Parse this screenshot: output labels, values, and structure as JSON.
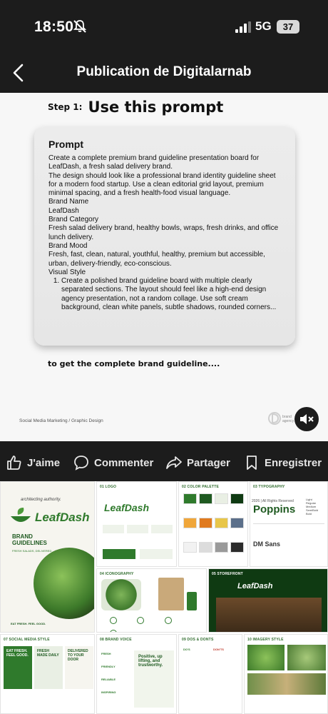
{
  "status": {
    "time": "18:50",
    "network": "5G",
    "battery": "37"
  },
  "nav": {
    "title": "Publication de Digitalarnab"
  },
  "post": {
    "step_label": "Step 1:",
    "step_title": "Use this prompt",
    "prompt_heading": "Prompt",
    "prompt_paragraphs": [
      "Create a complete premium brand guideline presentation board for LeafDash, a fresh salad delivery brand.",
      "The design should look like a professional brand identity guideline sheet for a modern food startup. Use a clean editorial grid layout, premium minimal spacing, and a fresh health-food visual language.",
      "Brand Name",
      "LeafDash",
      "Brand Category",
      "Fresh salad delivery brand, healthy bowls, wraps, fresh drinks, and office lunch delivery.",
      "Brand Mood",
      "Fresh, fast, clean, natural, youthful, healthy, premium but accessible, urban, delivery-friendly, eco-conscious.",
      "Visual Style"
    ],
    "prompt_list_item": "Create a polished brand guideline board with multiple clearly separated sections. The layout should feel like a high-end design agency presentation, not a random collage. Use soft cream background, clean white panels, subtle shadows, rounded corners...",
    "cta": "to get the complete brand guideline....",
    "footer": "Social Media Marketing / Graphic Design",
    "brand_mark": "brand agency"
  },
  "actions": {
    "like": "J'aime",
    "comment": "Commenter",
    "share": "Partager",
    "save": "Enregistrer"
  },
  "board": {
    "tagline": "architecting authority.",
    "brand": "LeafDash",
    "guidelines_title": "BRAND GUIDELINES",
    "guidelines_sub": "FRESH SALADS, DELIVERED",
    "eat_fresh": "EAT FRESH. FEEL GOOD.",
    "sections": {
      "logo": "01 LOGO",
      "palette": "02 COLOR PALETTE",
      "typography": "03 TYPOGRAPHY",
      "icons": "04 ICONOGRAPHY",
      "storefront": "05 STOREFRONT",
      "social": "07 SOCIAL MEDIA STYLE",
      "voice": "08 BRAND VOICE",
      "dos": "09 DOS & DONTS",
      "imagery": "10 IMAGERY STYLE"
    },
    "typo_font_main": "Poppins",
    "typo_font_secondary": "DM Sans",
    "typo_copyright": "2026 | All Rights Reserved",
    "typo_weights": [
      "Light",
      "Regular",
      "Medium",
      "SemiBold",
      "Bold"
    ],
    "social_posts": [
      "EAT FRESH. FEEL GOOD.",
      "FRESH MADE DAILY",
      "DELIVERED TO YOUR DOOR"
    ],
    "voice_quote": "Positive, up lifting, and trustworthy.",
    "voice_items": [
      "FRESH",
      "FRIENDLY",
      "RELIABLE",
      "INSPIRING"
    ],
    "dos_label": "DO'S",
    "donts_label": "DON'TS",
    "storefront_sign": "LeafDash",
    "colors": [
      "#2f7a2c",
      "#1f5a21",
      "#e9efe4",
      "#0f3a12",
      "#f0a63a",
      "#e07a1f",
      "#e8c64a",
      "#5b6f8a",
      "#f2f2f2",
      "#dcdcdc",
      "#9a9a9a",
      "#2b2b2b"
    ]
  }
}
